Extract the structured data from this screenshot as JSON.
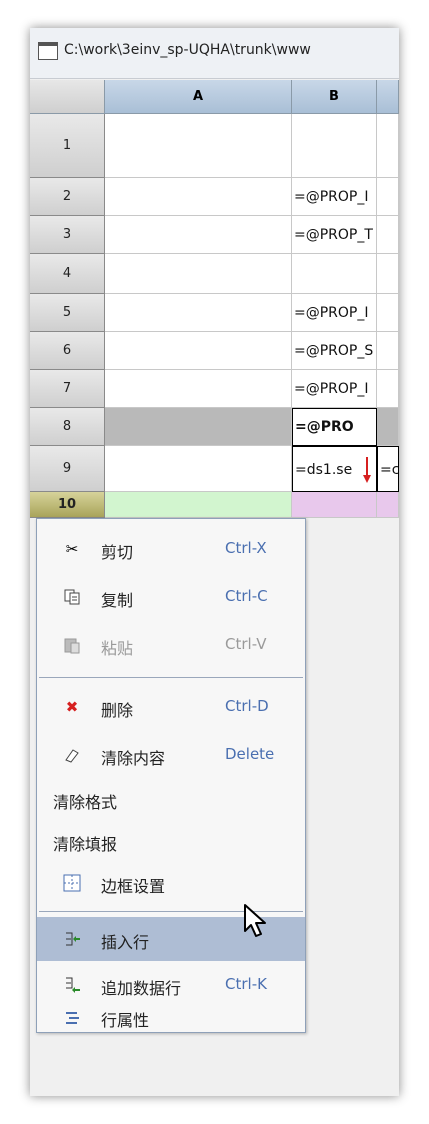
{
  "window": {
    "title": "C:\\work\\3einv_sp-UQHA\\trunk\\www"
  },
  "grid": {
    "columns": [
      "",
      "A",
      "B",
      ""
    ],
    "rows": [
      {
        "num": "1",
        "b": ""
      },
      {
        "num": "2",
        "b": "=@PROP_I"
      },
      {
        "num": "3",
        "b": "=@PROP_T"
      },
      {
        "num": "4",
        "b": ""
      },
      {
        "num": "5",
        "b": "=@PROP_I"
      },
      {
        "num": "6",
        "b": "=@PROP_S"
      },
      {
        "num": "7",
        "b": "=@PROP_I"
      },
      {
        "num": "8",
        "b": "=@PRO"
      },
      {
        "num": "9",
        "b": "=ds1.se",
        "c": "=c"
      },
      {
        "num": "10",
        "b": ""
      }
    ]
  },
  "context_menu": {
    "items": [
      {
        "label": "剪切",
        "shortcut": "Ctrl-X",
        "icon": "scissors-icon"
      },
      {
        "label": "复制",
        "shortcut": "Ctrl-C",
        "icon": "copy-icon"
      },
      {
        "label": "粘贴",
        "shortcut": "Ctrl-V",
        "icon": "paste-icon",
        "disabled": true
      },
      {
        "label": "删除",
        "shortcut": "Ctrl-D",
        "icon": "delete-icon"
      },
      {
        "label": "清除内容",
        "shortcut": "Delete",
        "icon": "eraser-icon"
      },
      {
        "label": "清除格式"
      },
      {
        "label": "清除填报"
      },
      {
        "label": "边框设置",
        "icon": "border-icon"
      },
      {
        "label": "插入行",
        "icon": "insert-row-icon"
      },
      {
        "label": "追加数据行",
        "shortcut": "Ctrl-K",
        "icon": "append-row-icon"
      },
      {
        "label": "行属性",
        "icon": "row-properties-icon"
      }
    ]
  },
  "colors": {
    "accent": "#4a6fb0",
    "hover": "#aebdd4",
    "delete": "#d62020"
  }
}
